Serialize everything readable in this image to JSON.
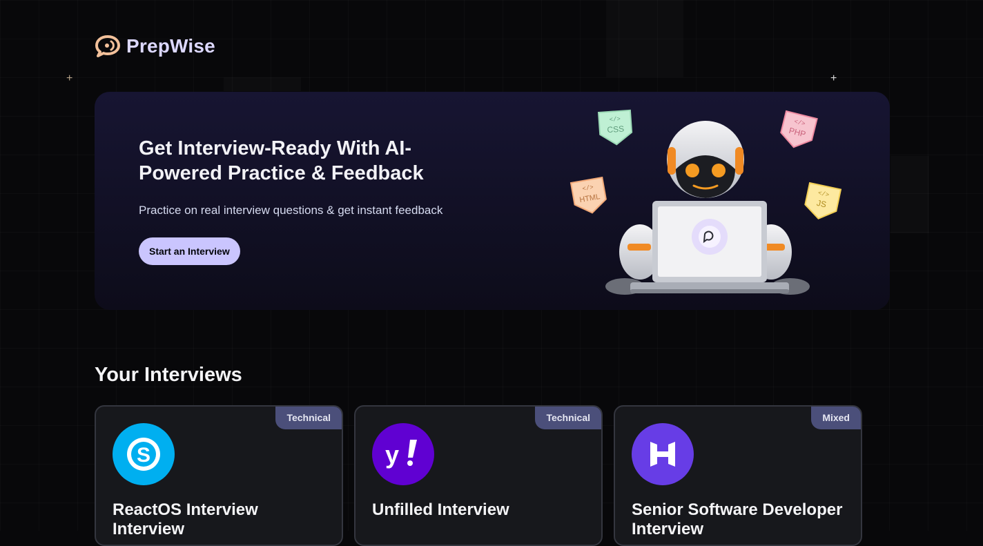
{
  "brand": {
    "name": "PrepWise"
  },
  "hero": {
    "title": "Get Interview-Ready With AI-Powered Practice & Feedback",
    "subtitle": "Practice on real interview questions & get instant feedback",
    "cta_label": "Start an Interview",
    "tech_tags": [
      "CSS",
      "PHP",
      "HTML",
      "JS"
    ]
  },
  "interviews": {
    "heading": "Your Interviews",
    "cards": [
      {
        "title": "ReactOS Interview Interview",
        "type": "Technical",
        "logo": "skype-icon",
        "logo_color": "#00aff0"
      },
      {
        "title": "Unfilled Interview",
        "type": "Technical",
        "logo": "yahoo-icon",
        "logo_color": "#6001d2"
      },
      {
        "title": "Senior Software Developer Interview",
        "type": "Mixed",
        "logo": "hostinger-icon",
        "logo_color": "#673de6"
      }
    ]
  },
  "colors": {
    "accent": "#cac5fe",
    "badge": "#4b4f7a",
    "background": "#08080a"
  }
}
